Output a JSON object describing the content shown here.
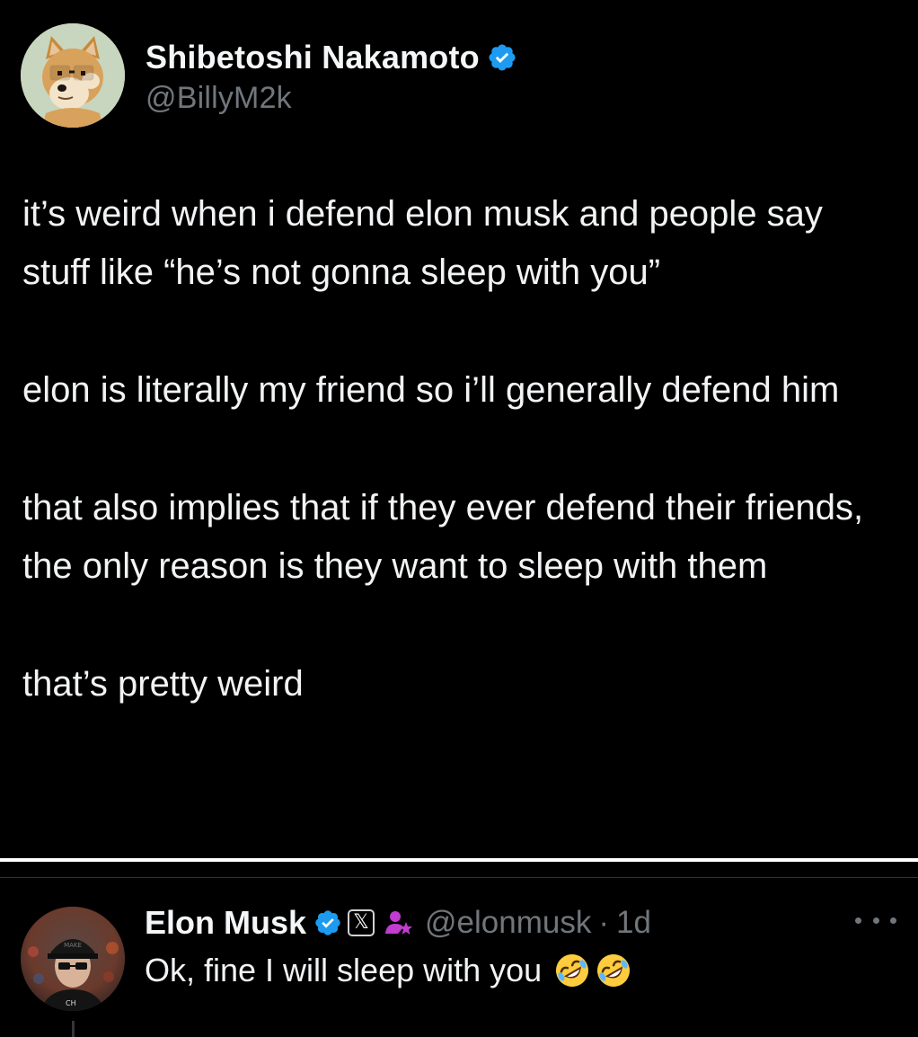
{
  "colors": {
    "background": "#000000",
    "primary_text": "#f2f3f4",
    "secondary_text": "#71767b",
    "verified_blue": "#1d9bf0",
    "affiliate_pink": "#c13ccf",
    "separator": "#2f3336"
  },
  "main_tweet": {
    "author": {
      "display_name": "Shibetoshi Nakamoto",
      "handle": "@BillyM2k",
      "verified_icon": "verified-badge-icon",
      "avatar_icon": "doge-avatar"
    },
    "paragraphs": [
      "it’s weird when i defend elon musk and people say stuff like “he’s not gonna sleep with you”",
      "elon is literally my friend so i’ll generally defend him",
      "that also implies that if they ever defend their friends, the only reason is they want to sleep with them",
      "that’s pretty weird"
    ]
  },
  "reply": {
    "author": {
      "display_name": "Elon Musk",
      "handle": "@elonmusk",
      "separator": "·",
      "time": "1d",
      "verified_icon": "verified-badge-icon",
      "org_badge": "𝕏",
      "affiliate_icon": "affiliate-person-icon"
    },
    "text": "Ok, fine I will sleep with you",
    "emojis": [
      "rolling-on-floor-laughing",
      "rolling-on-floor-laughing"
    ],
    "more_icon": "more-horizontal-icon"
  }
}
